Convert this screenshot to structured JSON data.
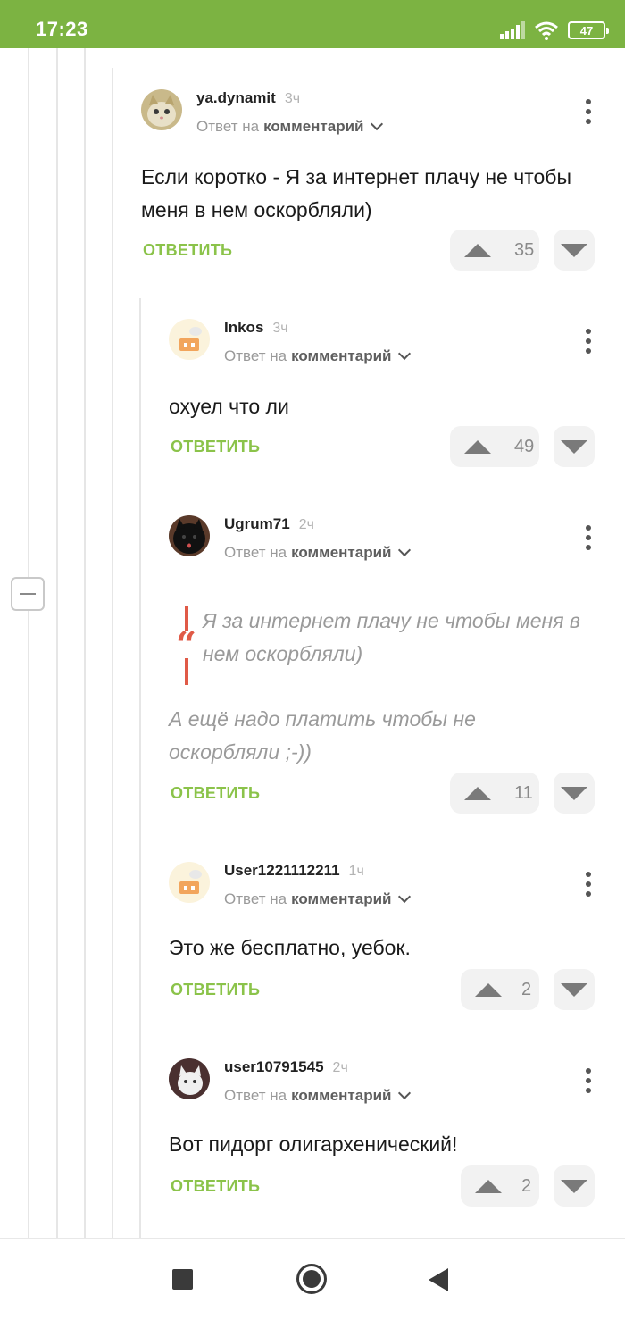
{
  "status_bar": {
    "time": "17:23",
    "battery": "47"
  },
  "comments": [
    {
      "username": "ya.dynamit",
      "time_ago": "3ч",
      "reply_prefix": "Ответ на",
      "reply_target": "комментарий",
      "text": "Если коротко - Я за интернет плачу не чтобы меня в нем оскорбляли)",
      "reply_label": "ОТВЕТИТЬ",
      "votes": "35"
    },
    {
      "username": "Inkos",
      "time_ago": "3ч",
      "reply_prefix": "Ответ на",
      "reply_target": "комментарий",
      "text": "охуел что ли",
      "reply_label": "ОТВЕТИТЬ",
      "votes": "49"
    },
    {
      "username": "Ugrum71",
      "time_ago": "2ч",
      "reply_prefix": "Ответ на",
      "reply_target": "комментарий",
      "quote": "Я за интернет плачу не чтобы меня в нем оскорбляли)",
      "text": "А ещё надо платить чтобы не оскорбляли ;-))",
      "reply_label": "ОТВЕТИТЬ",
      "votes": "11"
    },
    {
      "username": "User1221112211",
      "time_ago": "1ч",
      "reply_prefix": "Ответ на",
      "reply_target": "комментарий",
      "text": "Это же бесплатно, уебок.",
      "reply_label": "ОТВЕТИТЬ",
      "votes": "2"
    },
    {
      "username": "user10791545",
      "time_ago": "2ч",
      "reply_prefix": "Ответ на",
      "reply_target": "комментарий",
      "text": "Вот пидорг олигархенический!",
      "reply_label": "ОТВЕТИТЬ",
      "votes": "2"
    }
  ],
  "colors": {
    "status_bar": "#7cb342",
    "accent": "#8bc34a",
    "quote_bar": "#e05a47"
  }
}
